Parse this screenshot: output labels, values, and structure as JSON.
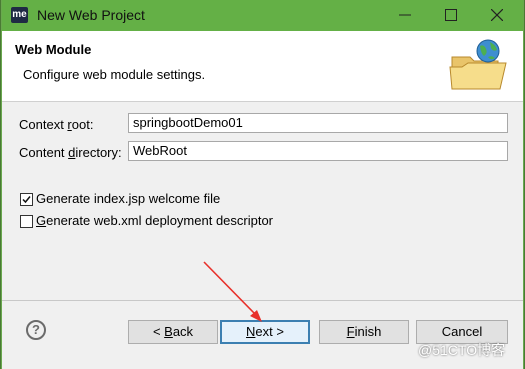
{
  "window": {
    "app_badge": "me",
    "title": "New Web Project"
  },
  "header": {
    "title": "Web Module",
    "description": "Configure web module settings."
  },
  "fields": {
    "context_root_label_pre": "Context ",
    "context_root_label_ul": "r",
    "context_root_label_post": "oot:",
    "context_root_value": "springbootDemo01",
    "content_dir_label_pre": "Content ",
    "content_dir_label_ul": "d",
    "content_dir_label_post": "irectory:",
    "content_dir_value": "WebRoot"
  },
  "options": [
    {
      "label": "Generate index.jsp welcome file",
      "checked": true
    },
    {
      "label_ul": "G",
      "label_rest": "enerate web.xml deployment descriptor",
      "checked": false
    }
  ],
  "buttons": {
    "back_pre": "< ",
    "back_ul": "B",
    "back_post": "ack",
    "next_ul": "N",
    "next_post": "ext >",
    "finish_ul": "F",
    "finish_post": "inish",
    "cancel": "Cancel"
  },
  "help": "?",
  "watermark": "@51CTO博客",
  "colors": {
    "titlebar": "#64b046",
    "arrow": "#e8302a",
    "default_button_border": "#3c7fb1"
  }
}
